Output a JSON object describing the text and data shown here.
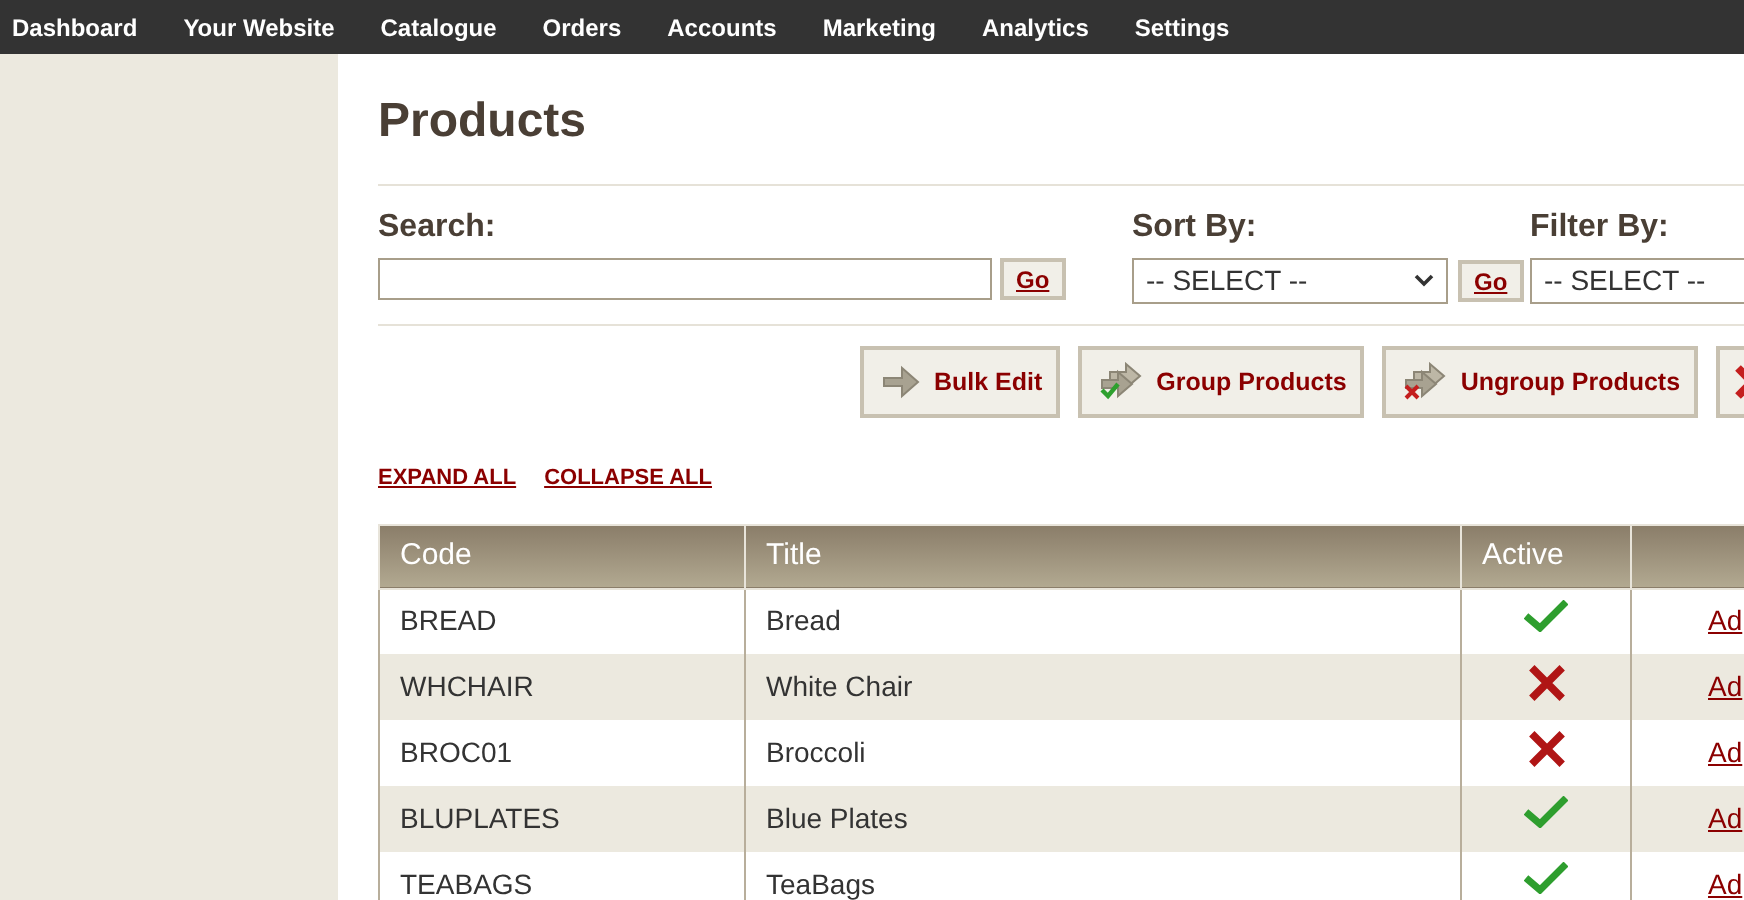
{
  "nav": [
    "Dashboard",
    "Your Website",
    "Catalogue",
    "Orders",
    "Accounts",
    "Marketing",
    "Analytics",
    "Settings"
  ],
  "title": "Products",
  "search": {
    "label": "Search:",
    "button": "Go"
  },
  "sort": {
    "label": "Sort By:",
    "value": "-- SELECT --",
    "button": "Go"
  },
  "filter": {
    "label": "Filter By:",
    "value": "-- SELECT --"
  },
  "actions": [
    {
      "label": "Bulk Edit",
      "kind": "edit"
    },
    {
      "label": "Group Products",
      "kind": "group"
    },
    {
      "label": "Ungroup Products",
      "kind": "ungroup"
    },
    {
      "kind": "delete"
    }
  ],
  "links": [
    "EXPAND ALL",
    "COLLAPSE ALL"
  ],
  "table": {
    "columns": [
      "Code",
      "Title",
      "Active"
    ],
    "rows": [
      {
        "code": "BREAD",
        "title": "Bread",
        "active": true,
        "column_4": "Ad"
      },
      {
        "code": "WHCHAIR",
        "title": "White Chair",
        "active": false,
        "column_4": "Ad"
      },
      {
        "code": "BROC01",
        "title": "Broccoli",
        "active": false,
        "column_4": "Ad"
      },
      {
        "code": "BLUPLATES",
        "title": "Blue Plates",
        "active": true,
        "column_4": "Ad"
      },
      {
        "code": "TEABAGS",
        "title": "TeaBags",
        "active": true,
        "column_4": "Ad"
      }
    ]
  }
}
